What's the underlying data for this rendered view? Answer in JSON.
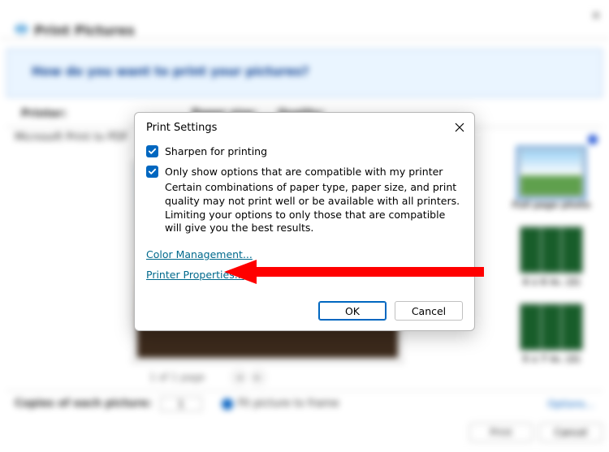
{
  "parent": {
    "title": "Print Pictures",
    "banner": "How do you want to print your pictures?",
    "labels": {
      "printer": "Printer:",
      "paper": "Paper size:",
      "quality": "Quality:"
    },
    "printer_name": "Microsoft Print to PDF",
    "page_indicator": "1 of 1 page",
    "thumbs": {
      "full": "Full page photo",
      "4x6": "4 x 6 in. (2)",
      "5x7": "5 x 7 in. (2)"
    },
    "copies_label": "Copies of each picture:",
    "copies_value": "1",
    "fit_label": "Fit picture to frame",
    "options_link": "Options...",
    "print_btn": "Print",
    "cancel_btn": "Cancel"
  },
  "dialog": {
    "title": "Print Settings",
    "sharpen": "Sharpen for printing",
    "compat_label": "Only show options that are compatible with my printer",
    "compat_desc": "Certain combinations of paper type, paper size, and print quality may not print well or be available with all printers.  Limiting your options to only those that are compatible will give you the best results.",
    "color_mgmt": "Color Management...",
    "printer_props": "Printer Properties...",
    "ok": "OK",
    "cancel": "Cancel"
  }
}
